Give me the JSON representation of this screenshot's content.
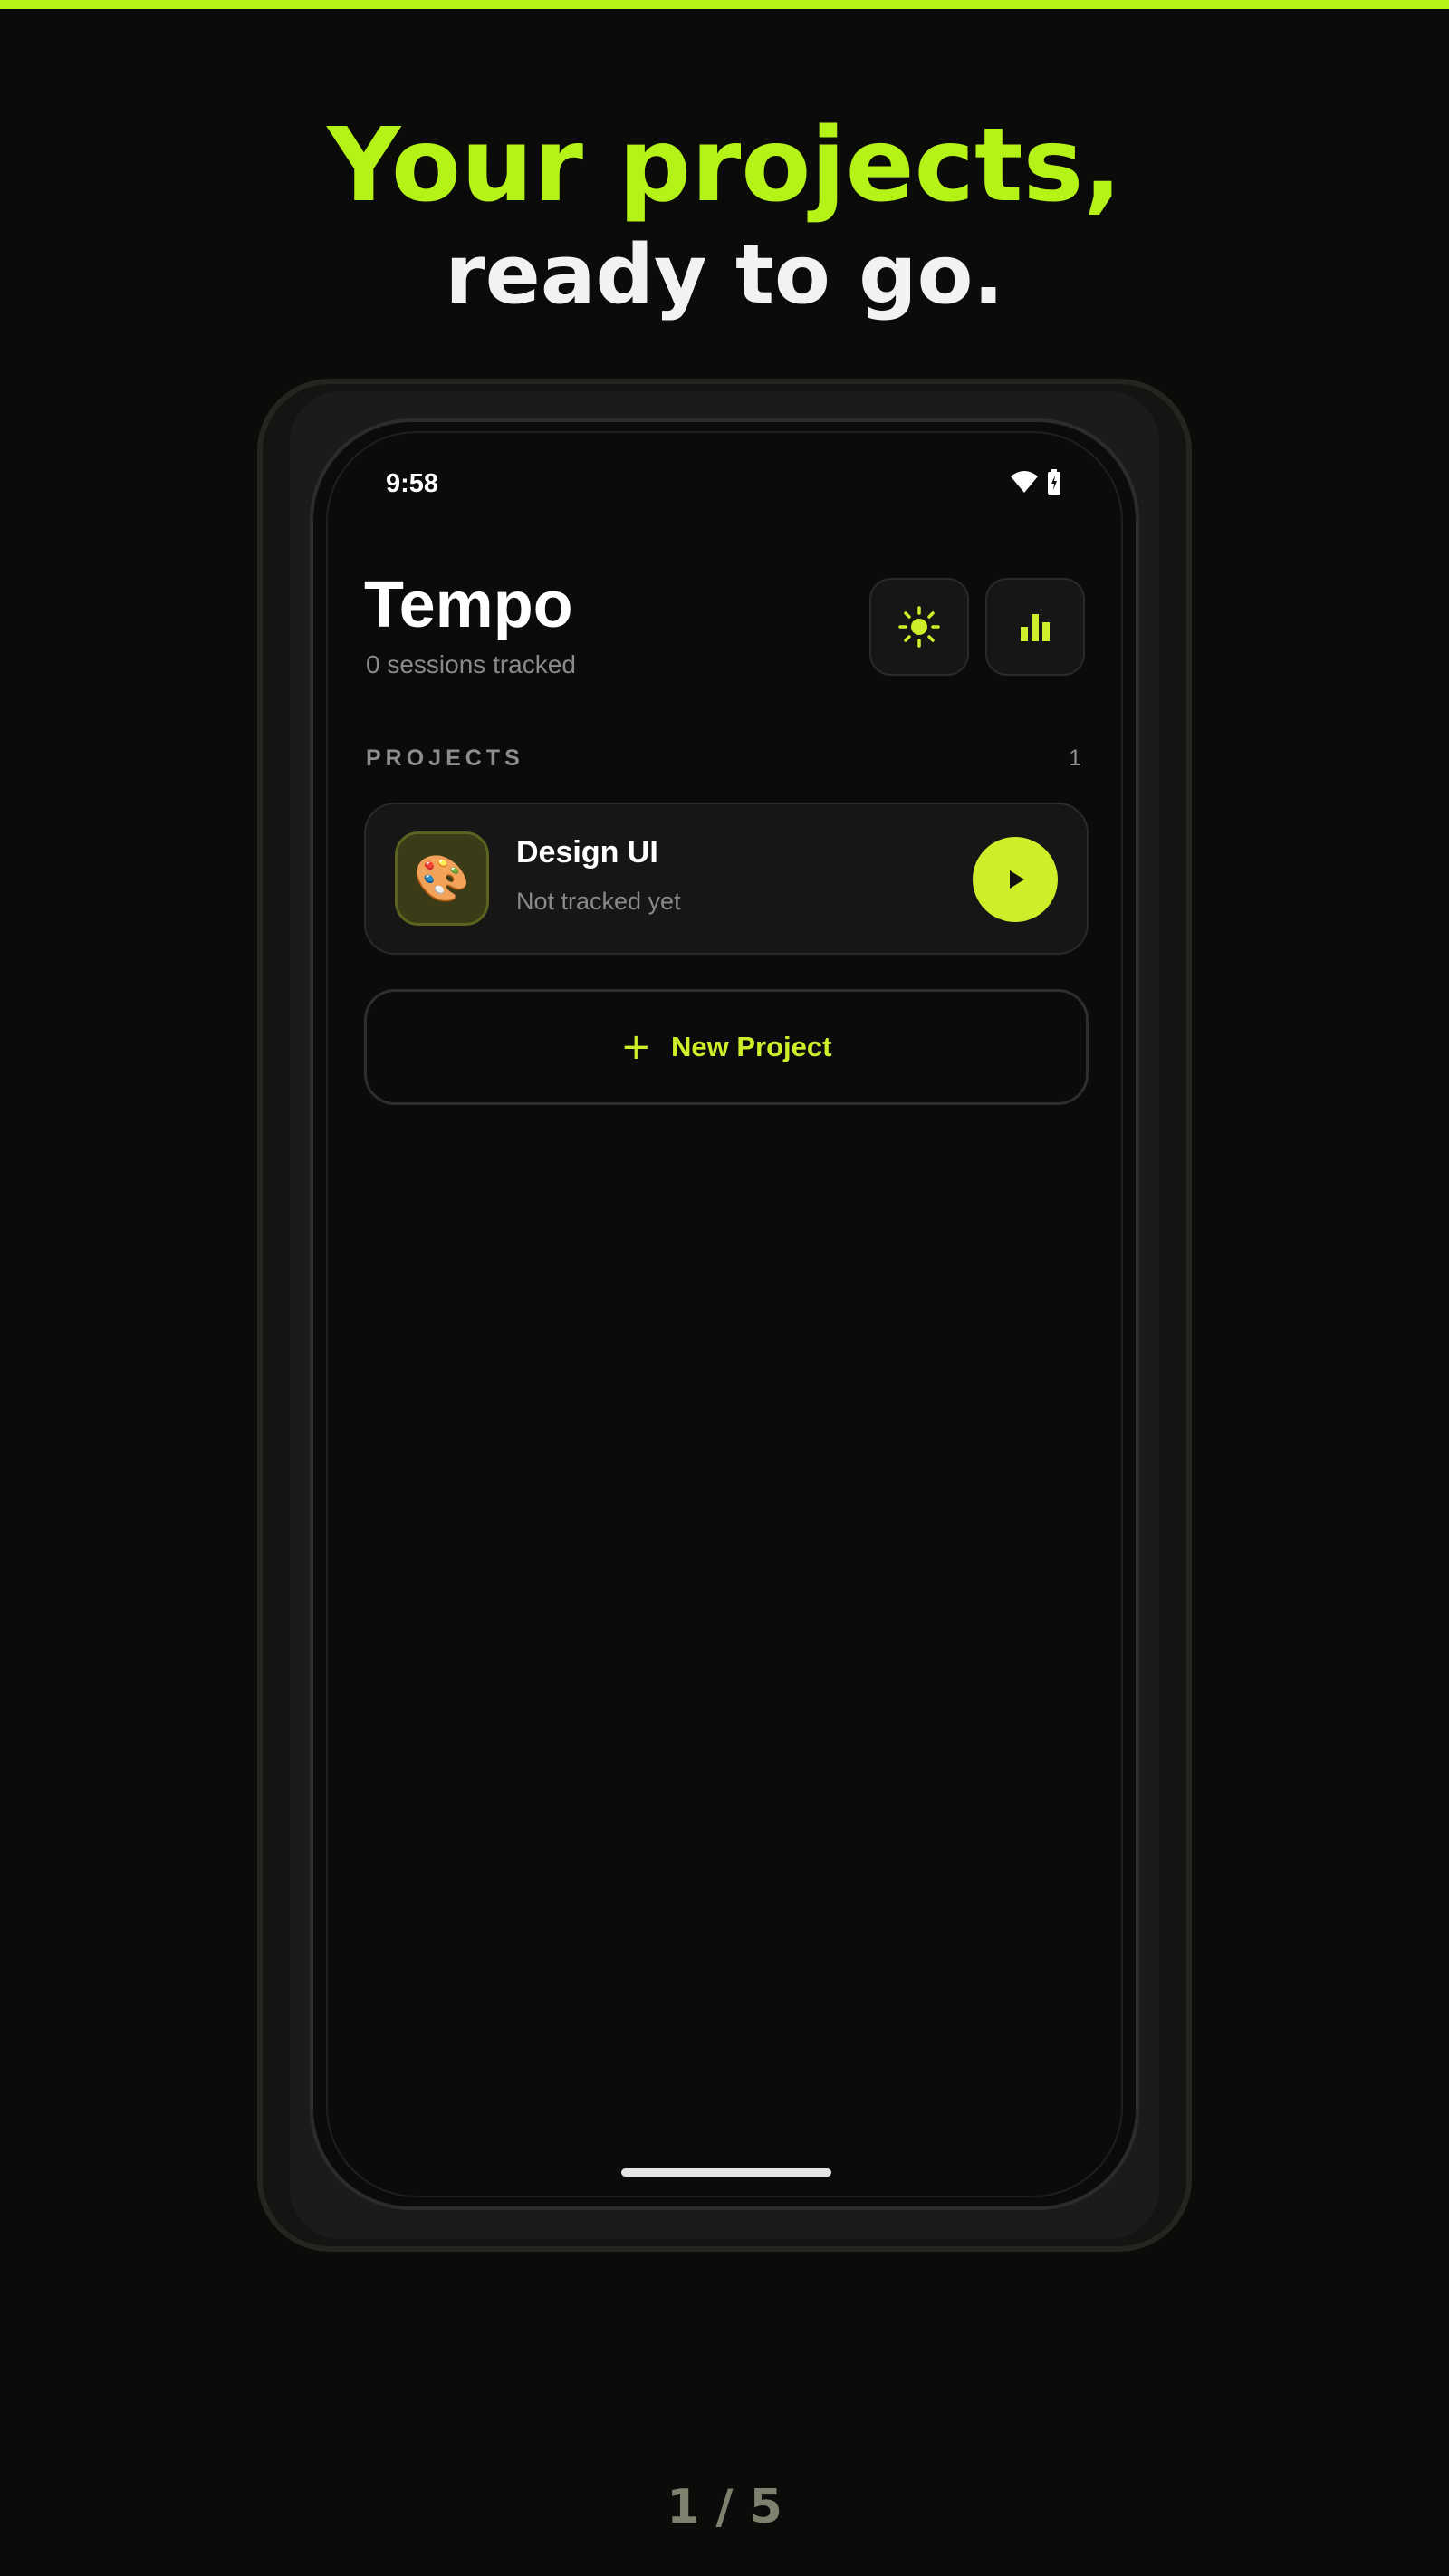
{
  "colors": {
    "accent": "#b5f217",
    "button_accent": "#cdef29",
    "background": "#0b0b0a"
  },
  "promo": {
    "headline": "Your projects,",
    "subheadline": "ready to go.",
    "pager": "1 / 5"
  },
  "status_bar": {
    "time": "9:58",
    "icons": [
      "wifi-icon",
      "battery-icon"
    ]
  },
  "header": {
    "title": "Tempo",
    "subtitle": "0 sessions tracked",
    "actions": [
      {
        "icon": "sun-icon",
        "name": "theme-toggle-button"
      },
      {
        "icon": "bar-chart-icon",
        "name": "stats-button"
      }
    ]
  },
  "projects_section": {
    "label": "PROJECTS",
    "count": "1",
    "items": [
      {
        "emoji": "🎨",
        "icon": "palette-icon",
        "name": "Design UI",
        "status": "Not tracked yet"
      }
    ]
  },
  "new_project": {
    "icon": "plus-icon",
    "label": "New Project"
  }
}
